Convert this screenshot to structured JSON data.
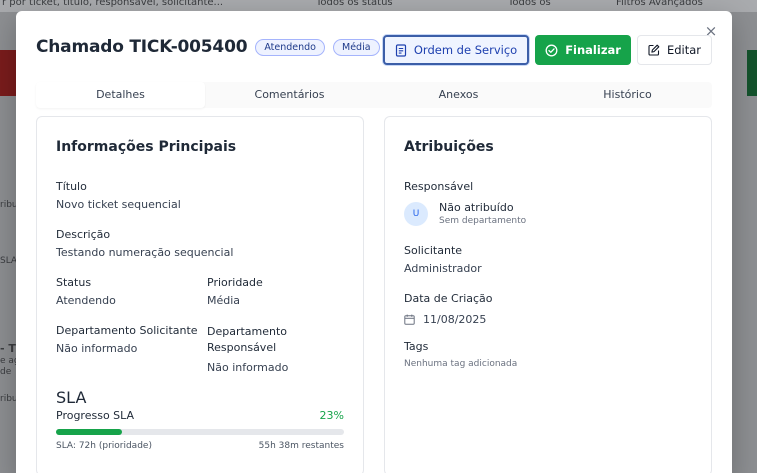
{
  "background": {
    "snippets": [
      "r por ticket, título, responsável, solicitante...",
      "Todos os status",
      "Todos os",
      "Filtros Avançados",
      "ribu",
      "SLA",
      "- T",
      "e ag",
      "de",
      "ribu"
    ]
  },
  "modal": {
    "close_icon": "×",
    "title": "Chamado TICK-005400",
    "status_badge": "Atendendo",
    "priority_badge": "Média",
    "actions": {
      "os_label": "Ordem de Serviço",
      "finish_label": "Finalizar",
      "edit_label": "Editar"
    },
    "tabs": [
      "Detalhes",
      "Comentários",
      "Anexos",
      "Histórico"
    ],
    "main_info": {
      "title": "Informações Principais",
      "titulo_label": "Título",
      "titulo_value": "Novo ticket sequencial",
      "descricao_label": "Descrição",
      "descricao_value": "Testando numeração sequencial",
      "status_label": "Status",
      "status_value": "Atendendo",
      "prioridade_label": "Prioridade",
      "prioridade_value": "Média",
      "dep_sol_label": "Departamento Solicitante",
      "dep_sol_value": "Não informado",
      "dep_resp_label": "Departamento Responsável",
      "dep_resp_value": "Não informado",
      "sla_label": "SLA",
      "sla_progress_label": "Progresso SLA",
      "sla_progress_value": "23%",
      "sla_progress_fraction": 0.23,
      "sla_meta": "SLA: 72h (prioridade)",
      "sla_remaining": "55h 38m restantes"
    },
    "assignments": {
      "title": "Atribuições",
      "responsavel_label": "Responsável",
      "avatar_initial": "U",
      "responsavel_value": "Não atribuído",
      "responsavel_dept": "Sem departamento",
      "solicitante_label": "Solicitante",
      "solicitante_value": "Administrador",
      "data_label": "Data de Criação",
      "data_value": "11/08/2025",
      "tags_label": "Tags",
      "tags_value": "Nenhuma tag adicionada"
    }
  },
  "colors": {
    "accent_green": "#16a34a",
    "accent_blue": "#1e40af"
  }
}
